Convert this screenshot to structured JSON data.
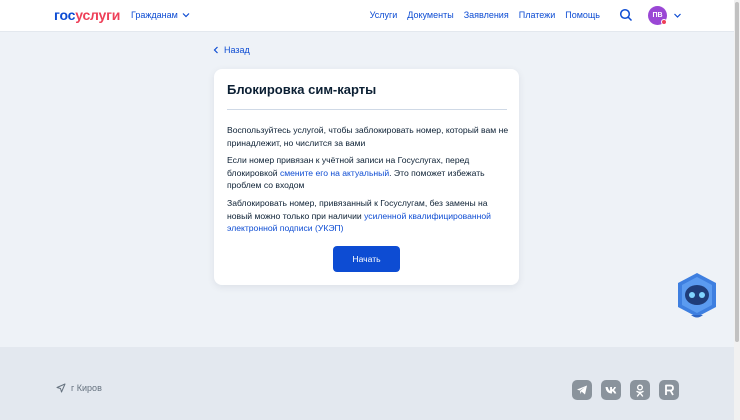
{
  "header": {
    "logo_part1": "гос",
    "logo_part2": "услуги",
    "role": "Гражданам",
    "nav": [
      "Услуги",
      "Документы",
      "Заявления",
      "Платежи",
      "Помощь"
    ],
    "avatar_initials": "ПВ"
  },
  "back_label": "Назад",
  "card": {
    "title": "Блокировка сим-карты",
    "p1": "Воспользуйтесь услугой, чтобы заблокировать номер, который вам не принадлежит, но числится за вами",
    "p2_before": "Если номер привязан к учётной записи на Госуслугах, перед блокировкой ",
    "p2_link": "смените его на актуальный",
    "p2_after": ". Это поможет избежать проблем со входом",
    "p3_before": "Заблокировать номер, привязанный к Госуслугам, без замены на новый можно только при наличии ",
    "p3_link": "усиленной квалифицированной электронной подписи (УКЭП)",
    "start_label": "Начать"
  },
  "footer": {
    "city": "г Киров",
    "social": [
      "telegram-icon",
      "vk-icon",
      "odnoklassniki-icon",
      "rutube-icon"
    ]
  },
  "colors": {
    "accent": "#0d4cd3",
    "logo_red": "#ee3f58",
    "avatar": "#9a47d5",
    "background": "#eef2f7",
    "footer": "#e3e8ef"
  }
}
